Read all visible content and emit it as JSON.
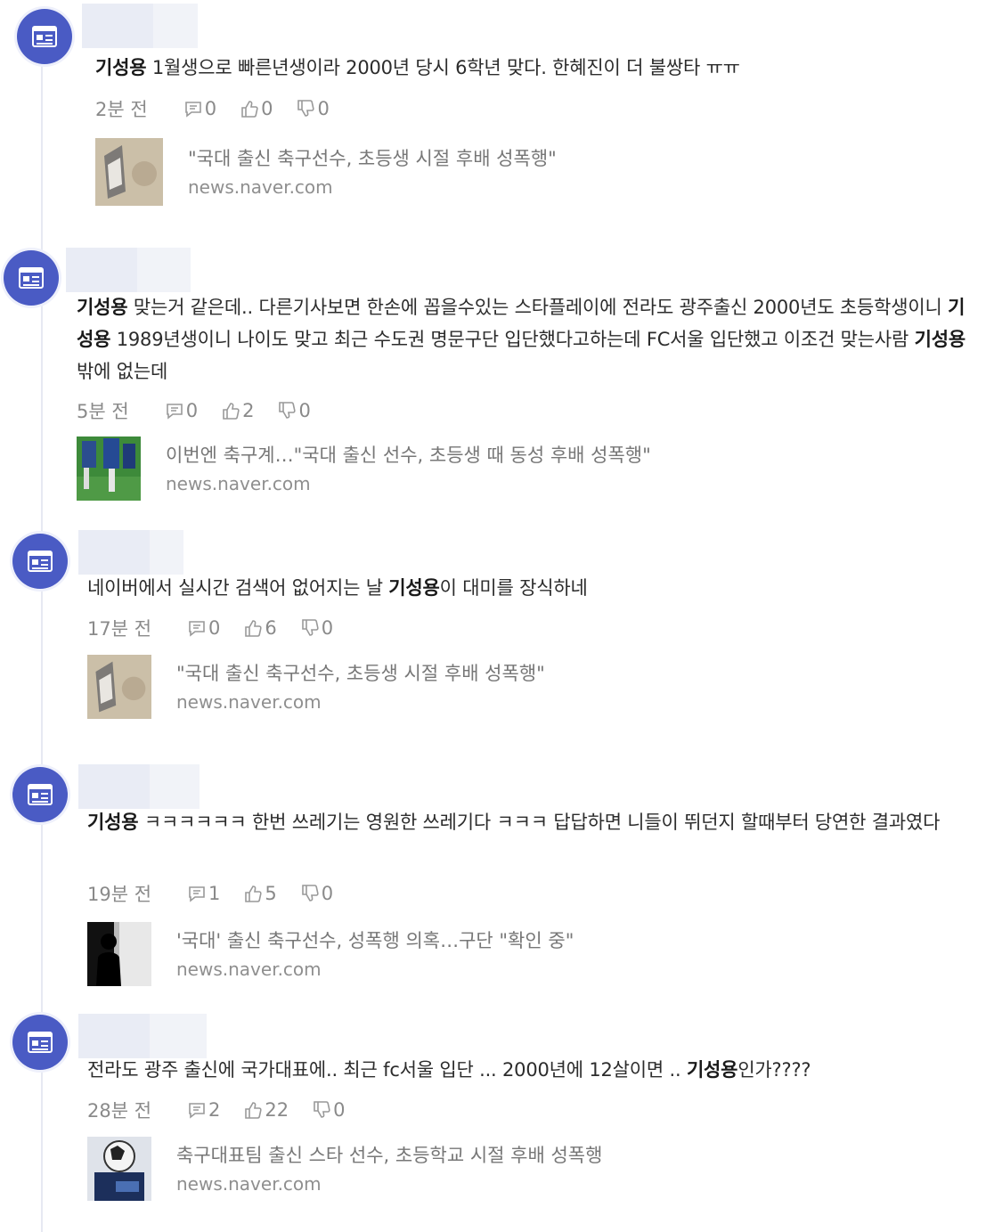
{
  "comments": [
    {
      "text_parts": [
        {
          "t": "기성용",
          "bold": true
        },
        {
          "t": " 1월생으로 빠른년생이라 2000년 당시 6학년 맞다. 한혜진이 더 불쌍타 ㅠㅠ",
          "bold": false
        }
      ],
      "time": "2분 전",
      "replies": "0",
      "likes": "0",
      "dislikes": "0",
      "link_title": "\"국대 출신 축구선수, 초등생 시절 후배 성폭행\"",
      "link_domain": "news.naver.com",
      "thumb": "sandy-figure"
    },
    {
      "text_parts": [
        {
          "t": "기성용",
          "bold": true
        },
        {
          "t": " 맞는거 같은데.. 다른기사보면 한손에 꼽을수있는 스타플레이에 전라도 광주출신 2000년도 초등학생이니 ",
          "bold": false
        },
        {
          "t": "기성용",
          "bold": true
        },
        {
          "t": " 1989년생이니 나이도 맞고 최근 수도권 명문구단 입단했다고하는데 FC서울 입단했고 이조건 맞는사람 ",
          "bold": false
        },
        {
          "t": "기성용",
          "bold": true
        },
        {
          "t": "밖에 없는데",
          "bold": false
        }
      ],
      "time": "5분 전",
      "replies": "0",
      "likes": "2",
      "dislikes": "0",
      "link_title": "이번엔 축구계…\"국대 출신 선수, 초등생 때 동성 후배 성폭행\"",
      "link_domain": "news.naver.com",
      "thumb": "soccer-players"
    },
    {
      "text_parts": [
        {
          "t": "네이버에서 실시간 검색어 없어지는 날 ",
          "bold": false
        },
        {
          "t": "기성용",
          "bold": true
        },
        {
          "t": "이 대미를 장식하네",
          "bold": false
        }
      ],
      "time": "17분 전",
      "replies": "0",
      "likes": "6",
      "dislikes": "0",
      "link_title": "\"국대 출신 축구선수, 초등생 시절 후배 성폭행\"",
      "link_domain": "news.naver.com",
      "thumb": "sandy-figure"
    },
    {
      "text_parts": [
        {
          "t": "기성용",
          "bold": true
        },
        {
          "t": " ㅋㅋㅋㅋㅋㅋ 한번 쓰레기는 영원한 쓰레기다 ㅋㅋㅋ 답답하면 니들이 뛰던지 할때부터 당연한 결과였다",
          "bold": false
        }
      ],
      "time": "19분 전",
      "replies": "1",
      "likes": "5",
      "dislikes": "0",
      "link_title": "'국대' 출신 축구선수, 성폭행 의혹…구단 \"확인 중\"",
      "link_domain": "news.naver.com",
      "thumb": "dark-silhouette"
    },
    {
      "text_parts": [
        {
          "t": "전라도 광주 출신에 국가대표에.. 최근 fc서울 입단 ... 2000년에 12살이면 .. ",
          "bold": false
        },
        {
          "t": "기성용",
          "bold": true
        },
        {
          "t": "인가????",
          "bold": false
        }
      ],
      "time": "28분 전",
      "replies": "2",
      "likes": "22",
      "dislikes": "0",
      "link_title": "축구대표팀 출신 스타 선수, 초등학교 시절 후배 성폭행",
      "link_domain": "news.naver.com",
      "thumb": "soccer-ball"
    }
  ]
}
